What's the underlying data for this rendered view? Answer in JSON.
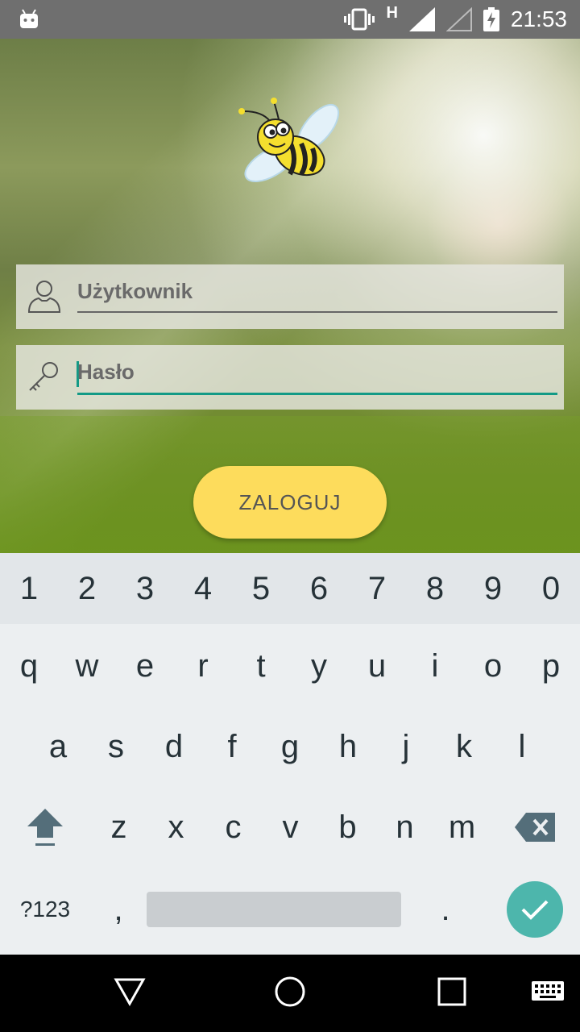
{
  "status_bar": {
    "time": "21:53",
    "network_type": "H",
    "icons": [
      "android-icon",
      "vibrate-icon",
      "signal-icon",
      "signal-empty-icon",
      "battery-charging-icon"
    ]
  },
  "login": {
    "username_placeholder": "Użytkownik",
    "password_placeholder": "Hasło",
    "login_button": "ZALOGUJ"
  },
  "keyboard": {
    "number_row": [
      "1",
      "2",
      "3",
      "4",
      "5",
      "6",
      "7",
      "8",
      "9",
      "0"
    ],
    "row1": [
      "q",
      "w",
      "e",
      "r",
      "t",
      "y",
      "u",
      "i",
      "o",
      "p"
    ],
    "row2": [
      "a",
      "s",
      "d",
      "f",
      "g",
      "h",
      "j",
      "k",
      "l"
    ],
    "row3": [
      "z",
      "x",
      "c",
      "v",
      "b",
      "n",
      "m"
    ],
    "symbols_label": "?123",
    "comma": ",",
    "period": ".",
    "icons": [
      "shift-icon",
      "backspace-icon",
      "enter-check-icon"
    ]
  },
  "navigation": {
    "icons": [
      "back-icon",
      "home-icon",
      "recents-icon",
      "keyboard-switch-icon"
    ]
  },
  "colors": {
    "accent": "#139a86",
    "button": "#fddc5c",
    "enter": "#4db6ac"
  }
}
